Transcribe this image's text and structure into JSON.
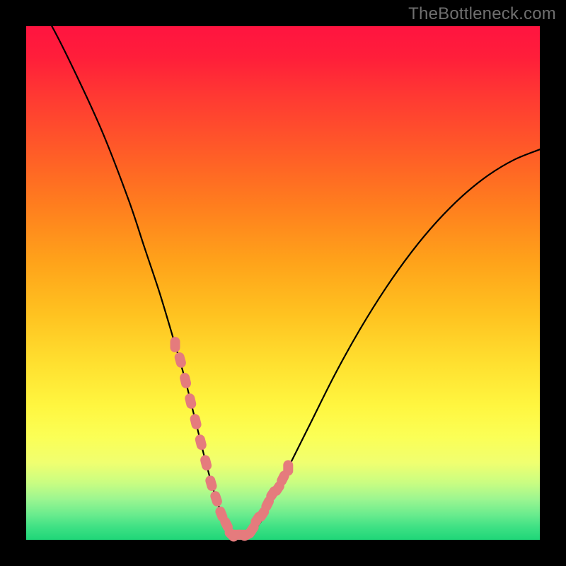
{
  "watermark": "TheBottleneck.com",
  "colors": {
    "frame": "#000000",
    "gradient_top": "#ff1440",
    "gradient_bottom": "#1fd678",
    "curve": "#000000",
    "marker": "#e57b7d"
  },
  "chart_data": {
    "type": "line",
    "title": "",
    "xlabel": "",
    "ylabel": "",
    "xlim": [
      0,
      100
    ],
    "ylim": [
      0,
      100
    ],
    "series": [
      {
        "name": "bottleneck-curve",
        "x": [
          0,
          5,
          10,
          15,
          20,
          23,
          26,
          29,
          31,
          33,
          35,
          37,
          39,
          41,
          43,
          46,
          50,
          55,
          60,
          65,
          70,
          75,
          80,
          85,
          90,
          95,
          100
        ],
        "values": [
          108,
          100,
          90,
          79,
          66,
          57,
          48,
          38,
          31,
          23,
          15,
          8,
          3,
          1,
          1,
          4,
          12,
          22,
          32,
          41,
          49,
          56,
          62,
          67,
          71,
          74,
          76
        ]
      }
    ],
    "markers": {
      "name": "highlight-dots",
      "x": [
        29,
        30,
        31,
        32,
        33,
        34,
        35,
        36,
        37,
        38,
        39,
        40,
        41,
        42,
        43,
        44,
        45,
        46,
        47,
        48,
        49,
        50,
        51
      ],
      "values": [
        38,
        35,
        31,
        27,
        23,
        19,
        15,
        11,
        8,
        5,
        3,
        1,
        1,
        1,
        1,
        2,
        4,
        5,
        7,
        9,
        10,
        12,
        14
      ]
    }
  }
}
